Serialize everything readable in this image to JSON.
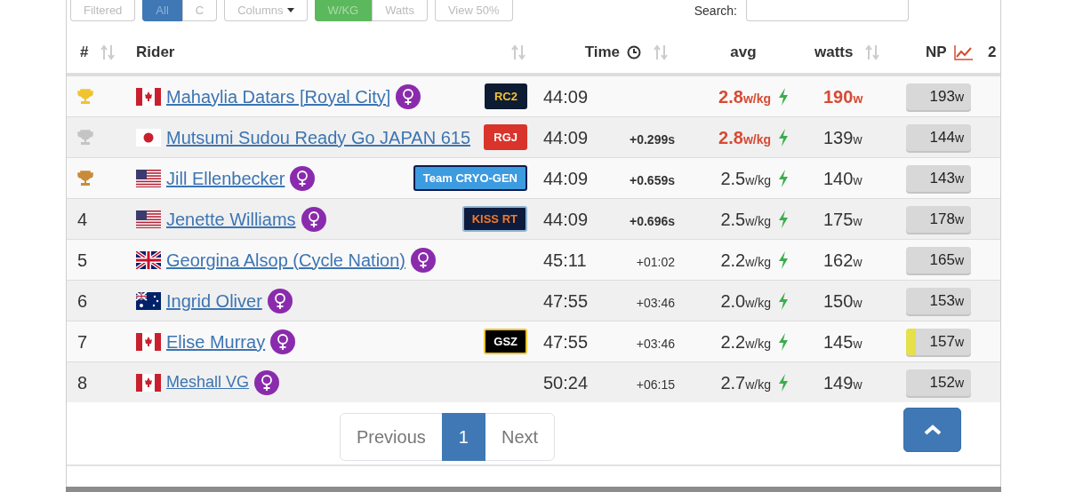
{
  "toolbar": {
    "buttons": [
      {
        "label": "Filtered",
        "selected": false,
        "kind": "plain"
      },
      {
        "label": "All",
        "selected": true,
        "kind": "blue"
      },
      {
        "label": "C",
        "selected": false,
        "kind": "plain"
      },
      {
        "label": "Columns",
        "selected": false,
        "kind": "dropdown"
      },
      {
        "label": "W/KG",
        "selected": true,
        "kind": "green"
      },
      {
        "label": "Watts",
        "selected": false,
        "kind": "plain"
      },
      {
        "label": "View 50%",
        "selected": false,
        "kind": "plain"
      }
    ],
    "search_label": "Search:"
  },
  "table": {
    "columns": [
      {
        "label": "#",
        "kind": "sortable"
      },
      {
        "label": "Rider",
        "kind": "sortable"
      },
      {
        "label": "Time",
        "kind": "timed"
      },
      {
        "label": "avg",
        "kind": "plain"
      },
      {
        "label": "watts",
        "kind": "sortable"
      },
      {
        "label": "NP",
        "kind": "chart"
      },
      {
        "label": "2",
        "kind": "plain"
      }
    ],
    "rows": [
      {
        "rank": {
          "kind": "trophy",
          "color": "#f0c330"
        },
        "flag": {
          "kind": "canada"
        },
        "name": "Mahaylia Datars [Royal City]",
        "female": true,
        "team": {
          "label": "RC2",
          "color": "#0d1b33",
          "kind": "gold"
        },
        "time": "44:09",
        "avg": "2.8",
        "avg_unit": "w/kg",
        "avg_best": true,
        "watts": "190",
        "watts_unit": "w",
        "watts_best": true,
        "np": "193",
        "np_unit": "w",
        "level": 0
      },
      {
        "rank": {
          "kind": "trophy",
          "color": "#c4c4c4"
        },
        "flag": {
          "kind": "japan"
        },
        "name": "Mutsumi Sudou Ready Go JAPAN 615",
        "female": false,
        "team": {
          "label": "RGJ",
          "color": "#d9342b",
          "kind": "plain"
        },
        "time": "44:09",
        "gap": "+0.299s",
        "gap_bold": true,
        "avg": "2.8",
        "avg_unit": "w/kg",
        "avg_best": true,
        "watts": "139",
        "watts_unit": "w",
        "watts_best": false,
        "np": "144",
        "np_unit": "w",
        "level": 0
      },
      {
        "rank": {
          "kind": "trophy",
          "color": "#c98b3a"
        },
        "flag": {
          "kind": "usa"
        },
        "name": "Jill Ellenbecker",
        "female": true,
        "team": {
          "label": "Team CRYO-GEN",
          "color": "#3d9be0",
          "kind": "navy-edge"
        },
        "time": "44:09",
        "gap": "+0.659s",
        "gap_bold": true,
        "avg": "2.5",
        "avg_unit": "w/kg",
        "avg_best": false,
        "watts": "140",
        "watts_unit": "w",
        "watts_best": false,
        "np": "143",
        "np_unit": "w",
        "level": 0
      },
      {
        "rank": {
          "kind": "number",
          "label": "4"
        },
        "flag": {
          "kind": "usa"
        },
        "name": "Jenette Williams",
        "female": true,
        "team": {
          "label": "KISS RT",
          "color": "#0d1b3d",
          "kind": "orange"
        },
        "time": "44:09",
        "gap": "+0.696s",
        "gap_bold": true,
        "avg": "2.5",
        "avg_unit": "w/kg",
        "avg_best": false,
        "watts": "175",
        "watts_unit": "w",
        "watts_best": false,
        "np": "178",
        "np_unit": "w",
        "level": 0
      },
      {
        "rank": {
          "kind": "number",
          "label": "5"
        },
        "flag": {
          "kind": "uk"
        },
        "name": "Georgina Alsop (Cycle Nation)",
        "female": true,
        "time": "45:11",
        "gap": "+01:02",
        "gap_bold": false,
        "avg": "2.2",
        "avg_unit": "w/kg",
        "avg_best": false,
        "watts": "162",
        "watts_unit": "w",
        "watts_best": false,
        "np": "165",
        "np_unit": "w",
        "level": 0
      },
      {
        "rank": {
          "kind": "number",
          "label": "6"
        },
        "flag": {
          "kind": "australia"
        },
        "name": "Ingrid Oliver",
        "female": true,
        "time": "47:55",
        "gap": "+03:46",
        "gap_bold": false,
        "avg": "2.0",
        "avg_unit": "w/kg",
        "avg_best": false,
        "watts": "150",
        "watts_unit": "w",
        "watts_best": false,
        "np": "153",
        "np_unit": "w",
        "level": 0
      },
      {
        "rank": {
          "kind": "number",
          "label": "7"
        },
        "flag": {
          "kind": "canada"
        },
        "name": "Elise Murray",
        "female": true,
        "team": {
          "label": "GSZ",
          "color": "#000000",
          "kind": "gold-edge"
        },
        "time": "47:55",
        "gap": "+03:46",
        "gap_bold": false,
        "avg": "2.2",
        "avg_unit": "w/kg",
        "avg_best": false,
        "watts": "145",
        "watts_unit": "w",
        "watts_best": false,
        "np": "157",
        "np_unit": "w",
        "level": 0.15
      },
      {
        "rank": {
          "kind": "number",
          "label": "8"
        },
        "flag": {
          "kind": "canada"
        },
        "name": "Meshall VG",
        "name_small": true,
        "female": true,
        "time": "50:24",
        "gap": "+06:15",
        "gap_bold": false,
        "avg": "2.7",
        "avg_unit": "w/kg",
        "avg_best": false,
        "watts": "149",
        "watts_unit": "w",
        "watts_best": false,
        "np": "152",
        "np_unit": "w",
        "level": 0
      }
    ]
  },
  "pagination": {
    "previous": "Previous",
    "pages": [
      {
        "label": "1",
        "selected": true
      }
    ],
    "next": "Next"
  }
}
